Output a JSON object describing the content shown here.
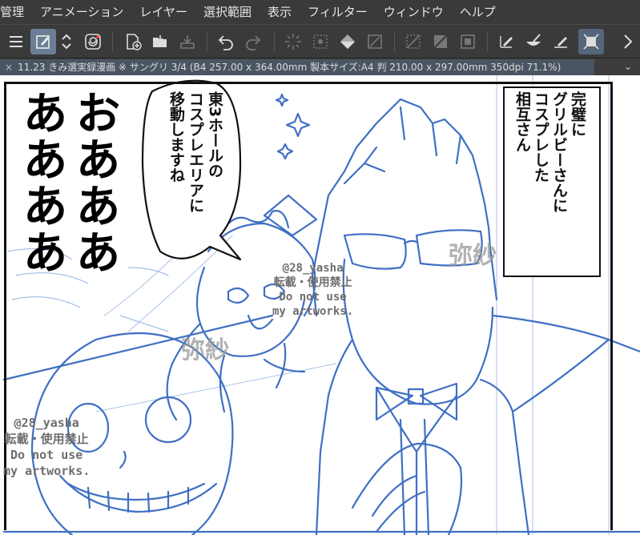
{
  "menu": [
    "管理",
    "アニメーション",
    "レイヤー",
    "選択範囲",
    "表示",
    "フィルター",
    "ウィンドウ",
    "ヘルプ"
  ],
  "toolbar": {
    "icons": [
      "menu-icon",
      "edit-canvas-icon",
      "up-down-icon",
      "spiral-icon",
      "new-file-icon",
      "open-folder-icon",
      "save-icon",
      "undo-icon",
      "redo-icon",
      "transform-icon",
      "selection-icon",
      "fill-icon",
      "deselect-icon",
      "invert-selection-icon",
      "crop-icon",
      "pen-tool-icon",
      "brush-tool-icon",
      "eraser-tool-icon",
      "move-tool-icon",
      "more-icon"
    ]
  },
  "document_tab": {
    "close": "×",
    "title": "11.23 きみ選実録漫画 ※ サングリ 3/4 (B4 257.00 x 364.00mm 製本サイズ:A4 判 210.00 x 297.00mm 350dpi 71.1%)",
    "chevron": "⌄"
  },
  "artwork": {
    "sfx": "おあああ\nああああ",
    "speech": "東3ホールの\nコスプレエリアに\n移動しますね",
    "caption": "完璧に\nグリルビーさんに\nコスプレした\n相互さん",
    "watermark": {
      "handle": "@28_yasha",
      "notice": "転載・使用禁止",
      "en1": "Do not use",
      "en2": "my artworks."
    },
    "signature": "弥紗"
  },
  "colors": {
    "menubar_bg": "#3a3a3a",
    "tab_bg": "#4a5563",
    "sketch_line": "#3f6fc4",
    "active_tool": "#6b7e95"
  }
}
